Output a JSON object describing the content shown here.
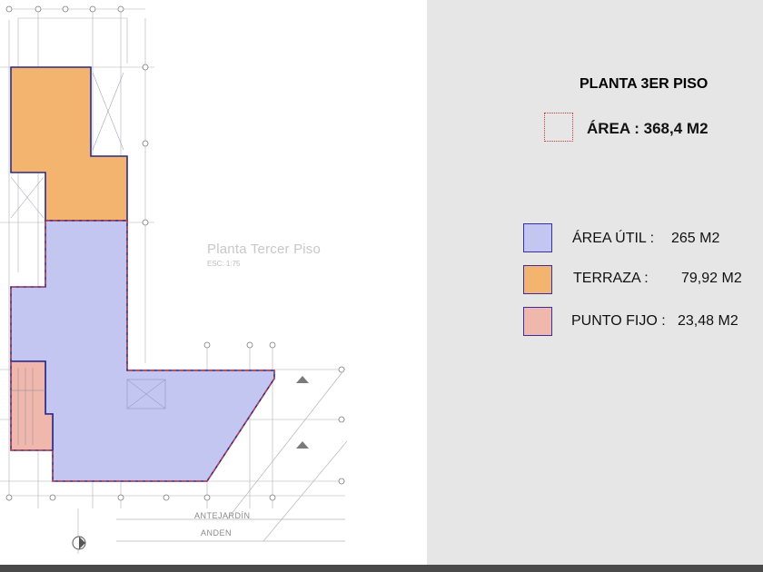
{
  "plan": {
    "title": "Planta Tercer Piso",
    "scale": "ESC: 1:75",
    "street_labels": [
      "ANTEJARDÍN",
      "ANDEN"
    ]
  },
  "legend": {
    "heading": "PLANTA 3ER PISO",
    "total": {
      "label": "ÁREA : 368,4 M2",
      "color": "#d23b3b"
    },
    "items": [
      {
        "name": "ÁREA ÚTIL :",
        "value": "265 M2",
        "color": "#c4c6f2"
      },
      {
        "name": "TERRAZA :",
        "value": "79,92 M2",
        "color": "#f2b46e"
      },
      {
        "name": "PUNTO FIJO :",
        "value": "23,48 M2",
        "color": "#f0b7ac"
      }
    ]
  },
  "accents": {
    "red": "#e2481f",
    "orange": "#f5870d"
  },
  "colors": {
    "outline": "#2a2a8c",
    "dash": "#d23b3b",
    "grid": "#9a9a9a"
  }
}
